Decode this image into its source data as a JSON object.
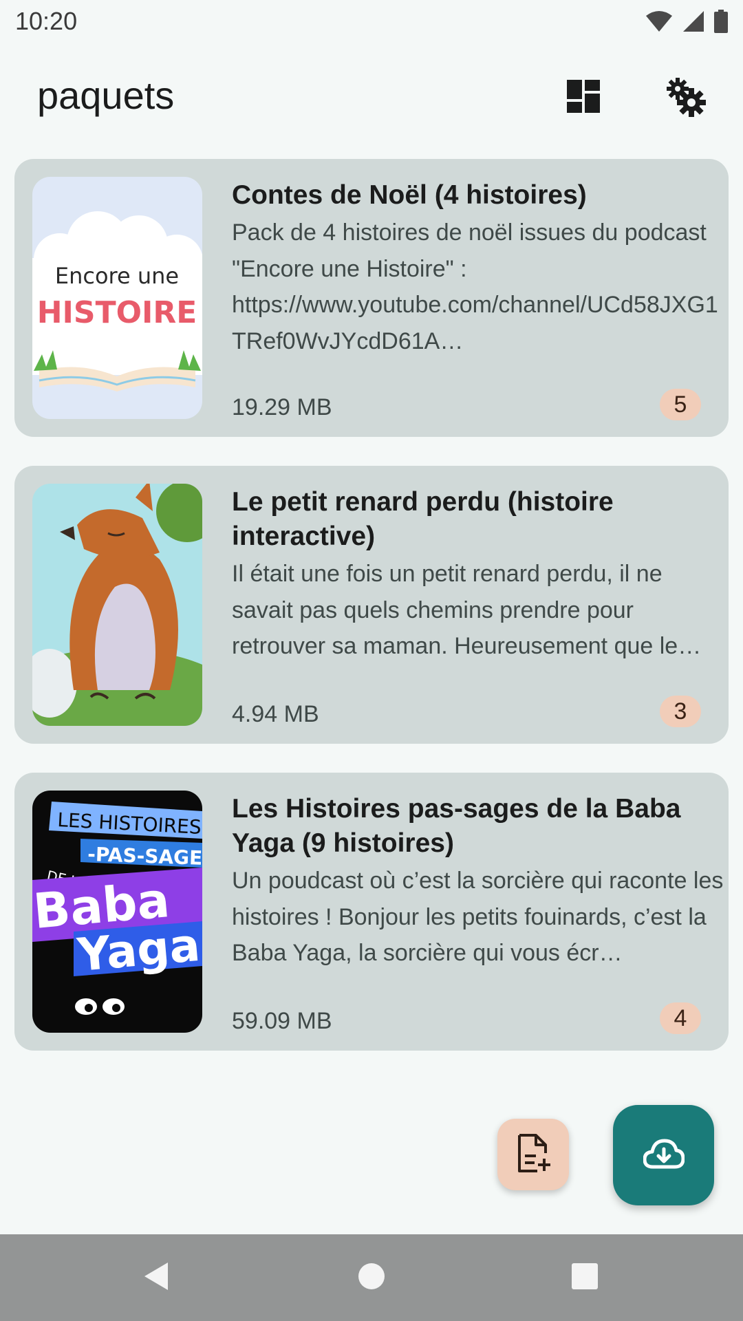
{
  "status_bar": {
    "time": "10:20",
    "icons": [
      "wifi-icon",
      "cellular-signal-icon",
      "battery-icon"
    ]
  },
  "app_bar": {
    "title": "paquets",
    "actions": [
      "dashboard-icon",
      "settings-gears-icon"
    ]
  },
  "packs": [
    {
      "title": "Contes de Noël (4 histoires)",
      "description": "Pack de 4 histoires de noël issues du podcast \"Encore une Histoire\" : https://www.youtube.com/channel/UCd58JXG1TRef0WvJYcdD61A…",
      "size": "19.29 MB",
      "count": "5",
      "cover": {
        "line1": "Encore une",
        "line2": "HISTOIRE"
      }
    },
    {
      "title": "Le petit renard perdu (histoire interactive)",
      "description": "Il était une fois un petit renard perdu, il ne savait pas quels chemins prendre pour retrouver sa maman. Heureusement que le…",
      "size": "4.94 MB",
      "count": "3",
      "cover": {}
    },
    {
      "title": "Les Histoires pas-sages de la Baba Yaga (9 histoires)",
      "description": "Un poudcast où c’est la sorcière qui raconte les histoires ! Bonjour les petits fouinards, c’est la Baba Yaga, la sorcière qui vous écr…",
      "size": "59.09 MB",
      "count": "4",
      "cover": {
        "line1": "LES HISTOIRES",
        "line2": "-PAS-SAGES",
        "line3": "DE LA",
        "line4": "Baba",
        "line5": "Yaga"
      }
    }
  ],
  "fabs": {
    "small": "note-add-icon",
    "large": "cloud-download-icon"
  },
  "navigation": [
    "back-icon",
    "home-icon",
    "recents-icon"
  ],
  "colors": {
    "background": "#f4f8f7",
    "card": "#d0d9d8",
    "badge": "#f1cdb9",
    "primary_fab": "#1a7b79",
    "nav_bar": "#939595"
  }
}
